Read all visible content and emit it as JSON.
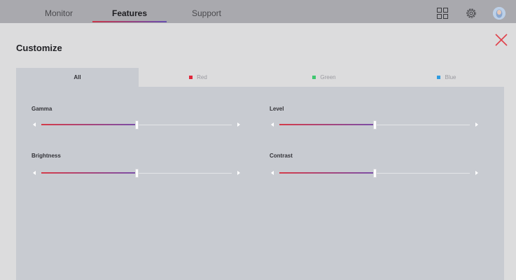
{
  "nav": {
    "tabs": [
      {
        "label": "Monitor"
      },
      {
        "label": "Features"
      },
      {
        "label": "Support"
      }
    ]
  },
  "page": {
    "title": "Customize"
  },
  "channel_tabs": [
    {
      "label": "All",
      "color": ""
    },
    {
      "label": "Red",
      "color": "#e0263a"
    },
    {
      "label": "Green",
      "color": "#3fc76f"
    },
    {
      "label": "Blue",
      "color": "#2f9be0"
    }
  ],
  "controls": [
    {
      "label": "Gamma",
      "value": 0.5
    },
    {
      "label": "Level",
      "value": 0.5
    },
    {
      "label": "Brightness",
      "value": 0.5
    },
    {
      "label": "Contrast",
      "value": 0.5
    }
  ],
  "colors": {
    "accent_start": "#d43b4a",
    "accent_end": "#7b4ea8",
    "close": "#e0404a"
  }
}
